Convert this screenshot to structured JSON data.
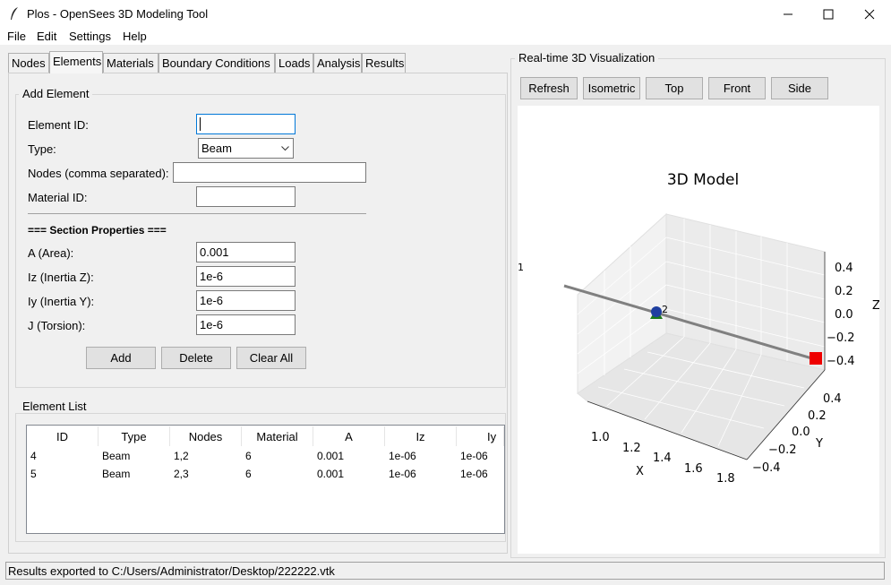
{
  "window": {
    "title": "Plos - OpenSees 3D Modeling Tool"
  },
  "menu": [
    "File",
    "Edit",
    "Settings",
    "Help"
  ],
  "tabs": [
    "Nodes",
    "Elements",
    "Materials",
    "Boundary Conditions",
    "Loads",
    "Analysis",
    "Results"
  ],
  "active_tab": "Elements",
  "add_element": {
    "group_label": "Add Element",
    "element_id_label": "Element ID:",
    "element_id_value": "",
    "type_label": "Type:",
    "type_value": "Beam",
    "nodes_label": "Nodes (comma separated):",
    "nodes_value": "",
    "material_label": "Material ID:",
    "material_value": "",
    "section_header": "=== Section Properties ===",
    "area_label": "A (Area):",
    "area_value": "0.001",
    "iz_label": "Iz (Inertia Z):",
    "iz_value": "1e-6",
    "iy_label": "Iy (Inertia Y):",
    "iy_value": "1e-6",
    "j_label": "J (Torsion):",
    "j_value": "1e-6",
    "add_label": "Add",
    "delete_label": "Delete",
    "clear_label": "Clear All"
  },
  "element_list": {
    "group_label": "Element List",
    "columns": [
      "ID",
      "Type",
      "Nodes",
      "Material",
      "A",
      "Iz",
      "Iy"
    ],
    "rows": [
      [
        "4",
        "Beam",
        "1,2",
        "6",
        "0.001",
        "1e-06",
        "1e-06"
      ],
      [
        "5",
        "Beam",
        "2,3",
        "6",
        "0.001",
        "1e-06",
        "1e-06"
      ]
    ]
  },
  "viz": {
    "group_label": "Real-time 3D Visualization",
    "buttons": [
      "Refresh",
      "Isometric",
      "Top",
      "Front",
      "Side"
    ],
    "plot_title": "3D Model",
    "x_label": "X",
    "y_label": "Y",
    "z_label": "Z",
    "x_ticks": [
      "1.0",
      "1.2",
      "1.4",
      "1.6",
      "1.8"
    ],
    "y_ticks": [
      "0.4",
      "0.2",
      "0.0",
      "−0.2",
      "−0.4"
    ],
    "z_ticks": [
      "0.4",
      "0.2",
      "0.0",
      "−0.2",
      "−0.4"
    ],
    "node_labels": [
      "1",
      "2"
    ],
    "colors": {
      "support": "#1a7a1a",
      "node": "#1f3fa0",
      "load": "#ee0000",
      "beam": "#808080"
    }
  },
  "status": {
    "text": "Results exported to C:/Users/Administrator/Desktop/222222.vtk"
  }
}
